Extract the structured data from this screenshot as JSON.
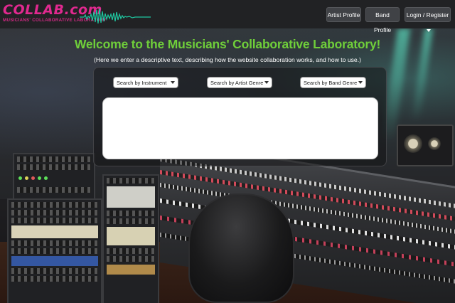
{
  "logo": {
    "title": "COLLAB.com",
    "subtitle": "MUSICIANS' COLLABORATIVE LABORATORY",
    "title_color": "#e0298f",
    "waveform_color": "#1fc7a0"
  },
  "nav": {
    "artist_profile": "Artist Profile",
    "band_profile": "Band Profile",
    "login_register": "Login / Register",
    "button_color": "#404246"
  },
  "hero": {
    "title": "Welcome to the Musicians' Collaborative Laboratory!",
    "description": "(Here we enter a descriptive text, describing how the website collaboration works, and how to use.)",
    "title_color": "#6fce3a"
  },
  "search": {
    "instrument": "Search by Instrument",
    "artist_genre": "Search by Artist Genre",
    "band_genre": "Search by Band Genre"
  },
  "icons": {
    "waveform": "waveform-icon",
    "dropdown": "chevron-down-icon"
  }
}
